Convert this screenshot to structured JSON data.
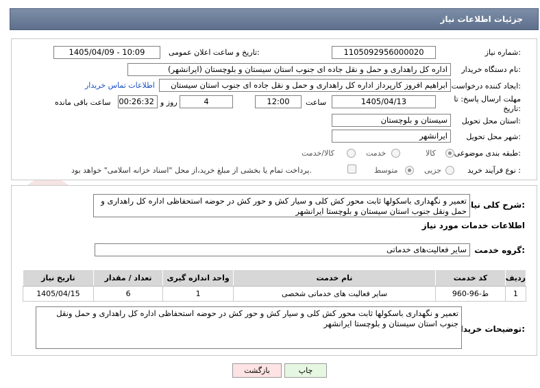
{
  "header": {
    "title": "جزئیات اطلاعات نیاز"
  },
  "fields": {
    "need_number_label": "شماره نیاز:",
    "need_number": "1105092956000020",
    "announce_label": "تاریخ و ساعت اعلان عمومی:",
    "announce_value": "1405/04/09 - 10:09",
    "buyer_org_label": "نام دستگاه خریدار:",
    "buyer_org": "اداره کل راهداری و حمل و نقل جاده ای جنوب استان سیستان و بلوچستان (ایرانشهر)",
    "creator_label": "ایجاد کننده درخواست:",
    "creator": "ابراهیم افروز کارپرداز اداره کل راهداری و حمل و نقل جاده ای جنوب استان سیستان",
    "contact_link": "اطلاعات تماس خریدار",
    "deadline_label_1": "مهلت ارسال پاسخ: تا",
    "deadline_label_2": "تاریخ:",
    "deadline_date": "1405/04/13",
    "time_label": "ساعت",
    "deadline_time": "12:00",
    "days_value": "4",
    "days_label": "روز و",
    "remaining_value": "00:26:32",
    "remaining_label": "ساعت باقی مانده",
    "province_label": "استان محل تحویل:",
    "province": "سیستان و بلوچستان",
    "city_label": "شهر محل تحویل:",
    "city": "ایرانشهر",
    "category_label": "طبقه بندی موضوعی:",
    "category_options": [
      "کالا",
      "خدمت",
      "کالا/خدمت"
    ],
    "process_label": "نوع فرآیند خرید :",
    "process_options": [
      "جزیی",
      "متوسط"
    ],
    "payment_note": "پرداخت تمام یا بخشی از مبلغ خرید،از محل \"اسناد خزانه اسلامی\" خواهد بود."
  },
  "summary": {
    "label": "شرح کلی نیاز:",
    "text": "تعمیر و نگهداری باسکولها ثابت محور کش کلی و سیار کش و حور کش در حوضه استحفاظی اداره کل راهداری و حمل ونقل جنوب استان سیستان و بلوچستا ایرانشهر"
  },
  "services": {
    "section_title": "اطلاعات خدمات مورد نیاز",
    "group_label": "گروه خدمت:",
    "group_value": "سایر فعالیت‌های خدماتی",
    "columns": [
      "ردیف",
      "کد خدمت",
      "نام خدمت",
      "واحد اندازه گیری",
      "تعداد / مقدار",
      "تاریخ نیاز"
    ],
    "rows": [
      [
        "1",
        "ط-96-960",
        "سایر فعالیت های خدماتی شخصی",
        "1",
        "6",
        "1405/04/15"
      ]
    ]
  },
  "buyer_notes": {
    "label": "توضیحات خریدار:",
    "text": "تعمیر و نگهداری باسکولها ثابت محور کش کلی و سیار کش و حور کش در حوضه استحفاظی اداره کل راهداری و حمل ونقل جنوب استان سیستان و بلوچستا ایرانشهر"
  },
  "buttons": {
    "print": "چاپ",
    "back": "بازگشت"
  },
  "colors": {
    "header": "#6a7b95",
    "link": "#1a4fc4",
    "back_button": "#fde3e3",
    "print_button": "#e6f7e1"
  }
}
